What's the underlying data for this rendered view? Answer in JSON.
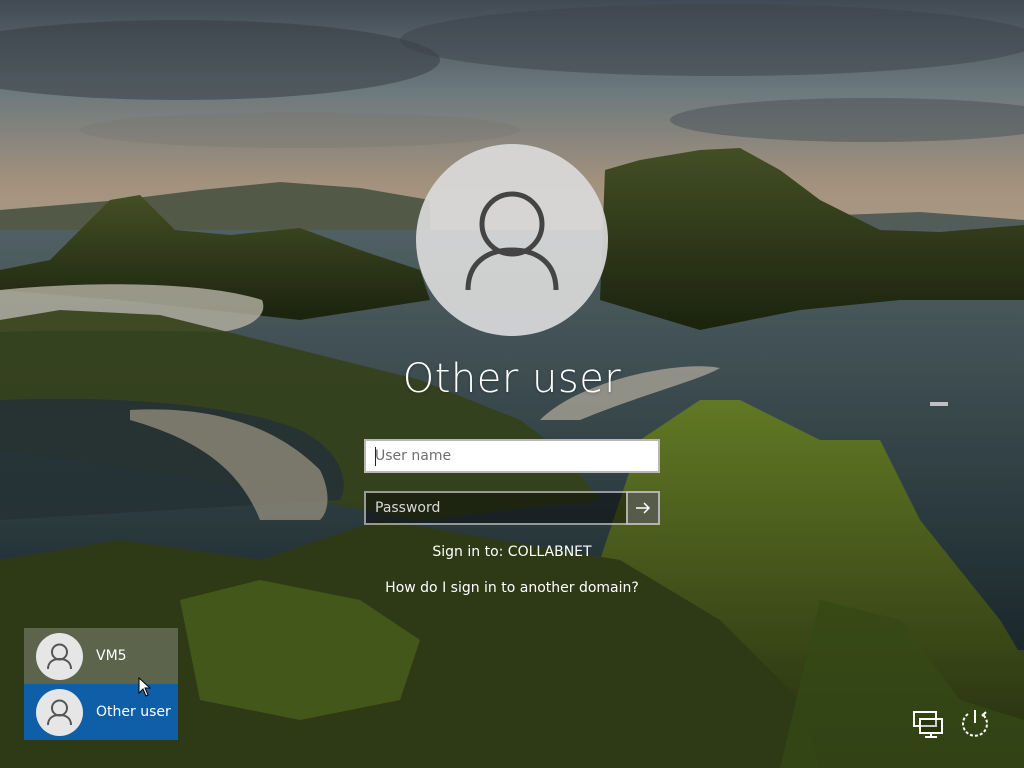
{
  "avatar": {
    "icon": "user-silhouette-icon"
  },
  "title": "Other user",
  "username_field": {
    "placeholder": "User name",
    "value": ""
  },
  "password_field": {
    "placeholder": "Password",
    "value": ""
  },
  "submit": {
    "icon": "arrow-right-icon"
  },
  "signin_to": "Sign in to: COLLABNET",
  "domain_help_link": "How do I sign in to another domain?",
  "users": [
    {
      "label": "VM5",
      "icon": "user-silhouette-icon",
      "selected": false
    },
    {
      "label": "Other user",
      "icon": "user-silhouette-icon",
      "selected": true
    }
  ],
  "system_icons": [
    {
      "name": "network-icon"
    },
    {
      "name": "power-icon"
    }
  ],
  "colors": {
    "selected_user": "#0e5fa8",
    "input_bg": "#ffffff",
    "password_bg": "#3a3a3a"
  }
}
